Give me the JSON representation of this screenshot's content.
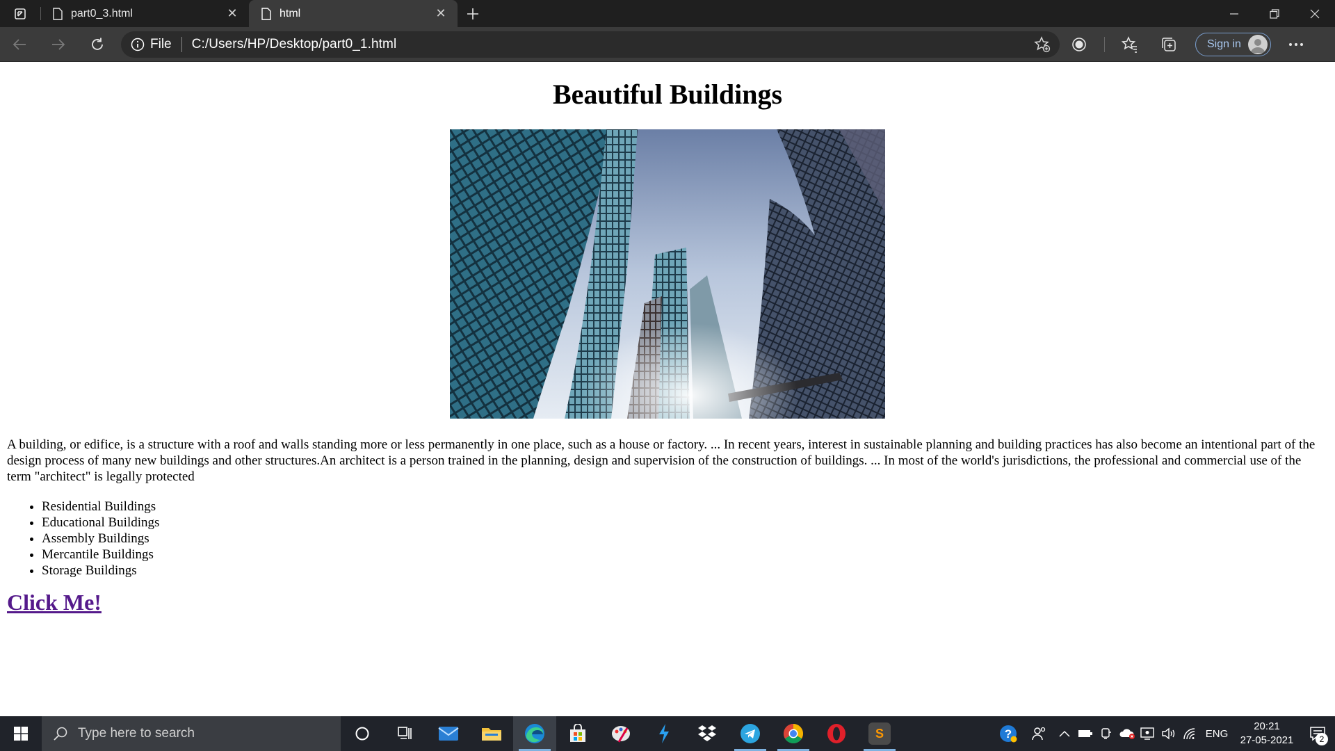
{
  "browser": {
    "tabs": [
      {
        "title": "part0_3.html",
        "active": false
      },
      {
        "title": "html",
        "active": true
      }
    ],
    "address": {
      "scheme_label": "File",
      "url": "C:/Users/HP/Desktop/part0_1.html"
    },
    "signin_label": "Sign in"
  },
  "page": {
    "heading": "Beautiful Buildings",
    "paragraph": "A building, or edifice, is a structure with a roof and walls standing more or less permanently in one place, such as a house or factory. ... In recent years, interest in sustainable planning and building practices has also become an intentional part of the design process of many new buildings and other structures.An architect is a person trained in the planning, design and supervision of the construction of buildings. ... In most of the world's jurisdictions, the professional and commercial use of the term \"architect\" is legally protected",
    "list": [
      "Residential Buildings",
      "Educational Buildings",
      "Assembly Buildings",
      "Mercantile Buildings",
      "Storage Buildings"
    ],
    "link_text": "Click Me!"
  },
  "taskbar": {
    "search_placeholder": "Type here to search",
    "language": "ENG",
    "time": "20:21",
    "date": "27-05-2021",
    "notification_count": "2"
  },
  "colors": {
    "link_visited": "#551a8b",
    "signin_accent": "#a9c8f0",
    "taskbar_bg": "#20232a"
  }
}
